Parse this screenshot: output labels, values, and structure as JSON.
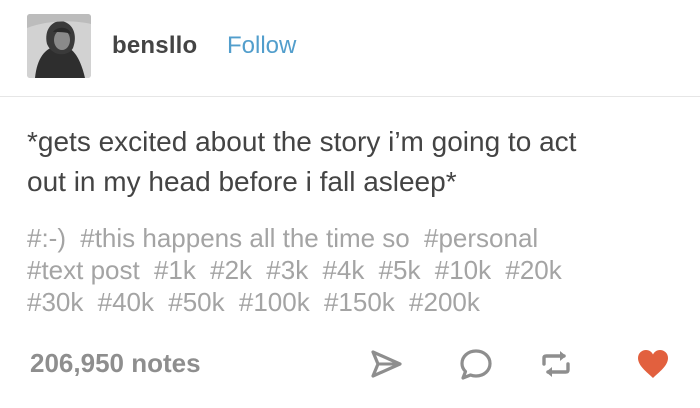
{
  "header": {
    "username": "bensllo",
    "follow_label": "Follow"
  },
  "post": {
    "text_line1": "*gets excited about the story i’m going to act",
    "text_line2": "out in my head before i fall asleep*"
  },
  "tags": [
    "#:-)",
    "#this happens all the time so",
    "#personal",
    "#text post",
    "#1k",
    "#2k",
    "#3k",
    "#4k",
    "#5k",
    "#10k",
    "#20k",
    "#30k",
    "#40k",
    "#50k",
    "#100k",
    "#150k",
    "#200k"
  ],
  "footer": {
    "notes": "206,950 notes",
    "actions": [
      {
        "icon": "share-icon"
      },
      {
        "icon": "reply-icon"
      },
      {
        "icon": "reblog-icon"
      },
      {
        "icon": "like-heart-icon"
      }
    ]
  },
  "colors": {
    "text": "#444444",
    "follow": "#529ecc",
    "tags": "#a4a4a4",
    "notes": "#8e8e8e",
    "icons": "#8e8e8e",
    "like": "#e2603e"
  }
}
